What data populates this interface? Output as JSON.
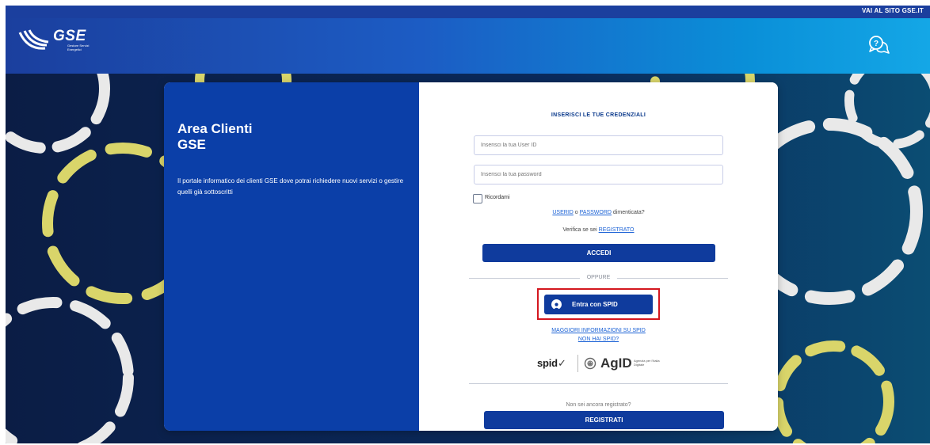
{
  "header": {
    "top_link": "VAI AL SITO GSE.IT",
    "logo_text": "GSE",
    "logo_subtitle": "Gestore Servizi Energetici",
    "help_icon": "help-chat-icon"
  },
  "intro": {
    "title_line1": "Area Clienti",
    "title_line2": "GSE",
    "description": "Il portale informatico dei clienti GSE dove potrai richiedere nuovi servizi o gestire quelli già sottoscritti"
  },
  "login": {
    "title": "INSERISCI LE TUE CREDENZIALI",
    "userid_placeholder": "Inserisci la tua User ID",
    "password_placeholder": "Inserisci la tua password",
    "remember_label": "Ricordami",
    "forgot_userid_link": "USERID",
    "forgot_connector": "o",
    "forgot_password_link": "PASSWORD",
    "forgot_suffix": "dimenticata?",
    "verify_prefix": "Verifica se sei",
    "verify_link": "REGISTRATO",
    "submit_label": "ACCEDI"
  },
  "alternative": {
    "separator_label": "OPPURE",
    "spid_button_label": "Entra con SPID",
    "spid_icon": "user-icon",
    "more_info_link": "MAGGIORI INFORMAZIONI SU SPID",
    "no_spid_link": "NON HAI SPID?",
    "spid_logo_text": "spid",
    "spid_logo_mark": "✓",
    "agid_logo_text": "AgID",
    "agid_subtitle": "Agenzia per l'Italia Digitale"
  },
  "register": {
    "prompt": "Non sei ancora registrato?",
    "button_label": "REGISTRATI"
  },
  "colors": {
    "brand_blue": "#0b3fa8",
    "button_blue": "#0f3b9d",
    "link_blue": "#1d63d6",
    "highlight_red": "#d4171f",
    "gear_yellow": "#d9d56a",
    "gear_white": "#e9e9e9"
  }
}
